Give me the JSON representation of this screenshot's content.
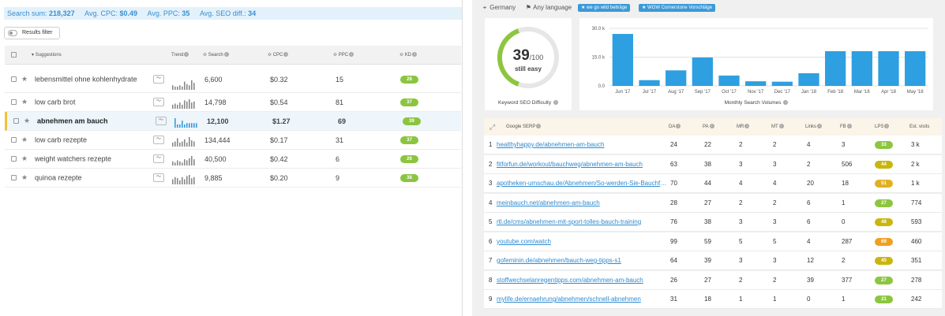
{
  "summary": {
    "search_sum_label": "Search sum:",
    "search_sum": "218,327",
    "cpc_label": "Avg. CPC:",
    "cpc": "$0.49",
    "ppc_label": "Avg. PPC:",
    "ppc": "35",
    "seo_label": "Avg. SEO diff.:",
    "seo": "34"
  },
  "filter_button": "Results filter",
  "keywords_table": {
    "headers": {
      "suggestions": "Suggestions",
      "trend": "Trend",
      "search": "Search",
      "cpc": "CPC",
      "ppc": "PPC",
      "kd": "KD"
    },
    "rows": [
      {
        "keyword": "lebensmittel ohne kohlenhydrate",
        "search": "6,600",
        "cpc": "$0.32",
        "ppc": "15",
        "kd": "28",
        "highlighted": false,
        "trend": [
          3,
          2,
          2,
          3,
          2,
          6,
          4,
          3,
          7,
          5
        ]
      },
      {
        "keyword": "low carb brot",
        "search": "14,798",
        "cpc": "$0.54",
        "ppc": "81",
        "kd": "37",
        "highlighted": false,
        "trend": [
          3,
          4,
          3,
          5,
          3,
          7,
          6,
          8,
          5,
          6
        ]
      },
      {
        "keyword": "abnehmen am bauch",
        "search": "12,100",
        "cpc": "$1.27",
        "ppc": "69",
        "kd": "39",
        "highlighted": true,
        "trend": [
          7,
          2,
          2,
          5,
          2,
          3,
          3,
          3,
          3,
          3
        ]
      },
      {
        "keyword": "low carb rezepte",
        "search": "134,444",
        "cpc": "$0.17",
        "ppc": "31",
        "kd": "37",
        "highlighted": false,
        "trend": [
          3,
          4,
          7,
          3,
          4,
          6,
          3,
          8,
          5,
          4
        ]
      },
      {
        "keyword": "weight watchers rezepte",
        "search": "40,500",
        "cpc": "$0.42",
        "ppc": "6",
        "kd": "26",
        "highlighted": false,
        "trend": [
          3,
          2,
          4,
          3,
          2,
          5,
          4,
          6,
          8,
          5
        ]
      },
      {
        "keyword": "quinoa rezepte",
        "search": "9,885",
        "cpc": "$0.20",
        "ppc": "9",
        "kd": "38",
        "highlighted": false,
        "trend": [
          4,
          6,
          5,
          3,
          6,
          4,
          7,
          8,
          5,
          6
        ]
      }
    ]
  },
  "location": {
    "country": "Germany",
    "language": "Any language"
  },
  "tags": [
    "★ we go wild beiträge",
    "★ WGW Cornerstone Vorschläge"
  ],
  "difficulty": {
    "score": "39",
    "max": "/100",
    "verdict": "still easy",
    "label": "Keyword SEO Difficulty",
    "fraction": 0.39,
    "color": "#8cc63f"
  },
  "chart_data": {
    "type": "bar",
    "title": "",
    "xlabel": "Monthly Search Volumes",
    "ylabel": "",
    "categories": [
      "Jun '17",
      "Jul '17",
      "Aug '17",
      "Sep '17",
      "Oct '17",
      "Nov '17",
      "Dec '17",
      "Jan '18",
      "Feb '18",
      "Mar '18",
      "Apr '18",
      "May '18"
    ],
    "values": [
      27100,
      3000,
      8100,
      14800,
      5400,
      2400,
      2200,
      6600,
      18100,
      18100,
      18100,
      18100
    ],
    "y_ticks": [
      "0.0",
      "15.0 k",
      "30.0 k"
    ],
    "ylim": [
      0,
      30000
    ],
    "bar_color": "#2e9fe0"
  },
  "serp": {
    "headers": {
      "google_serp": "Google SERP",
      "da": "DA",
      "pa": "PA",
      "mr": "MR",
      "mt": "MT",
      "links": "Links",
      "fb": "FB",
      "lps": "LPS",
      "visits": "Est. visits"
    },
    "rows": [
      {
        "rank": "1",
        "url": "healthyhappy.de/abnehmen-am-bauch",
        "da": "24",
        "pa": "22",
        "mr": "2",
        "mt": "2",
        "links": "4",
        "fb": "3",
        "lps": "33",
        "lps_color": "#8cc63f",
        "visits": "3 k"
      },
      {
        "rank": "2",
        "url": "fitforfun.de/workout/bauchweg/abnehmen-am-bauch",
        "da": "63",
        "pa": "38",
        "mr": "3",
        "mt": "3",
        "links": "2",
        "fb": "506",
        "lps": "44",
        "lps_color": "#c9b60d",
        "visits": "2 k"
      },
      {
        "rank": "3",
        "url": "apotheken-umschau.de/Abnehmen/So-werden-Sie-Bauchfett-los",
        "da": "70",
        "pa": "44",
        "mr": "4",
        "mt": "4",
        "links": "20",
        "fb": "18",
        "lps": "51",
        "lps_color": "#e0b020",
        "visits": "1 k"
      },
      {
        "rank": "4",
        "url": "meinbauch.net/abnehmen-am-bauch",
        "da": "28",
        "pa": "27",
        "mr": "2",
        "mt": "2",
        "links": "6",
        "fb": "1",
        "lps": "27",
        "lps_color": "#8cc63f",
        "visits": "774"
      },
      {
        "rank": "5",
        "url": "rtl.de/cms/abnehmen-mit-sport-tolles-bauch-training",
        "da": "76",
        "pa": "38",
        "mr": "3",
        "mt": "3",
        "links": "6",
        "fb": "0",
        "lps": "48",
        "lps_color": "#c9b60d",
        "visits": "593"
      },
      {
        "rank": "6",
        "url": "youtube.com/watch",
        "da": "99",
        "pa": "59",
        "mr": "5",
        "mt": "5",
        "links": "4",
        "fb": "287",
        "lps": "69",
        "lps_color": "#f0a020",
        "visits": "460"
      },
      {
        "rank": "7",
        "url": "gofeminin.de/abnehmen/bauch-weg-tipps-s1",
        "da": "64",
        "pa": "39",
        "mr": "3",
        "mt": "3",
        "links": "12",
        "fb": "2",
        "lps": "45",
        "lps_color": "#c9b60d",
        "visits": "351"
      },
      {
        "rank": "8",
        "url": "stoffwechselanregentipps.com/abnehmen-am-bauch",
        "da": "26",
        "pa": "27",
        "mr": "2",
        "mt": "2",
        "links": "39",
        "fb": "377",
        "lps": "27",
        "lps_color": "#8cc63f",
        "visits": "278"
      },
      {
        "rank": "9",
        "url": "mylife.de/ernaehrung/abnehmen/schnell-abnehmen",
        "da": "31",
        "pa": "18",
        "mr": "1",
        "mt": "1",
        "links": "0",
        "fb": "1",
        "lps": "21",
        "lps_color": "#8cc63f",
        "visits": "242"
      }
    ]
  }
}
